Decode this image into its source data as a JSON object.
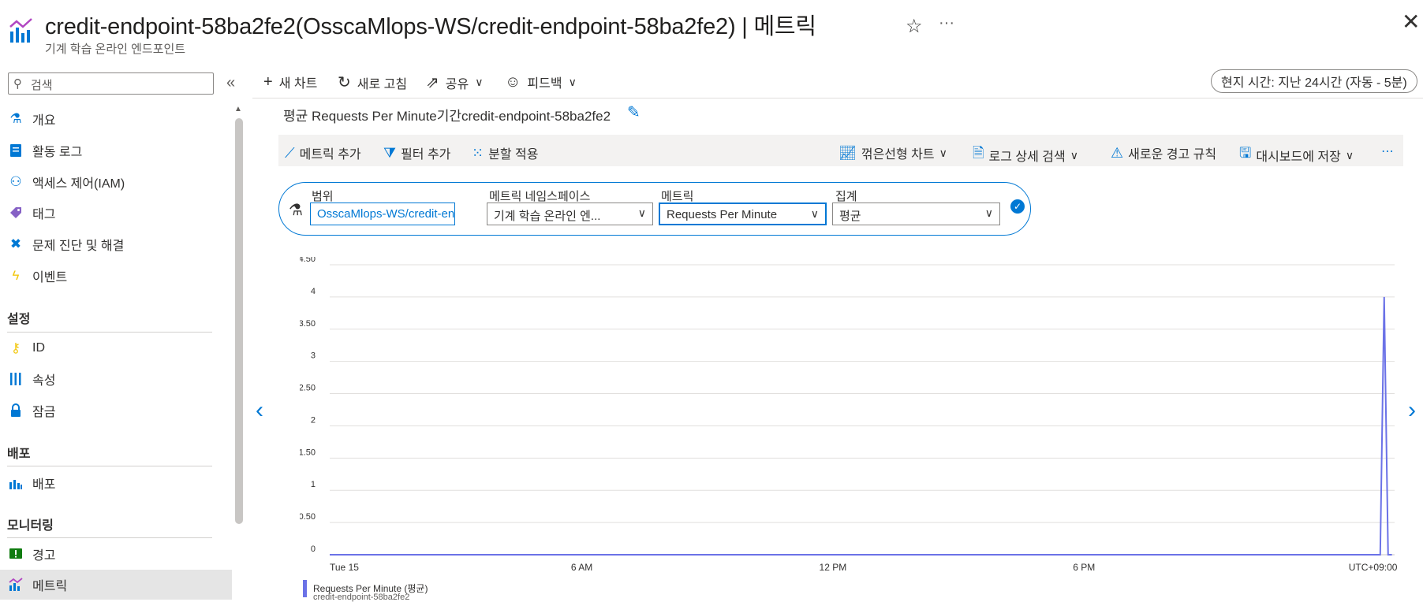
{
  "header": {
    "title": "credit-endpoint-58ba2fe2(OsscaMlops-WS/credit-endpoint-58ba2fe2) | 메트릭",
    "subtitle": "기계 학습 온라인 엔드포인트",
    "star_icon": "star-icon",
    "more_icon": "ellipsis-icon",
    "close_icon": "close-icon"
  },
  "sidebar": {
    "search_placeholder": "검색",
    "items": [
      {
        "label": "개요",
        "icon": "flask-icon",
        "color": "#0078d4"
      },
      {
        "label": "활동 로그",
        "icon": "log-icon",
        "color": "#0078d4"
      },
      {
        "label": "액세스 제어(IAM)",
        "icon": "people-icon",
        "color": "#0078d4"
      },
      {
        "label": "태그",
        "icon": "tag-icon",
        "color": "#8661c5"
      },
      {
        "label": "문제 진단 및 해결",
        "icon": "wrench-icon",
        "color": "#0078d4"
      },
      {
        "label": "이벤트",
        "icon": "bolt-icon",
        "color": "#f2c811"
      }
    ],
    "sections": [
      {
        "title": "설정",
        "items": [
          {
            "label": "ID",
            "icon": "key-icon",
            "color": "#f2c811"
          },
          {
            "label": "속성",
            "icon": "properties-icon",
            "color": "#0078d4"
          },
          {
            "label": "잠금",
            "icon": "lock-icon",
            "color": "#0078d4"
          }
        ]
      },
      {
        "title": "배포",
        "items": [
          {
            "label": "배포",
            "icon": "deploy-icon",
            "color": "#0078d4"
          }
        ]
      },
      {
        "title": "모니터링",
        "items": [
          {
            "label": "경고",
            "icon": "alert-icon",
            "color": "#107c10"
          },
          {
            "label": "메트릭",
            "icon": "metrics-icon",
            "color": "#0078d4",
            "selected": true
          }
        ]
      }
    ]
  },
  "commandbar": {
    "new_chart": "새 차트",
    "refresh": "새로 고침",
    "share": "공유",
    "feedback": "피드백",
    "time_range": "현지 시간: 지난 24시간 (자동 - 5분)"
  },
  "chart_header": {
    "title": "평균 Requests Per Minute기간credit-endpoint-58ba2fe2"
  },
  "toolbar": {
    "add_metric": "메트릭 추가",
    "add_filter": "필터 추가",
    "apply_split": "분할 적용",
    "chart_type": "꺾은선형 차트",
    "log_search": "로그 상세 검색",
    "new_alert": "새로운 경고 규칙",
    "save_dashboard": "대시보드에 저장",
    "more": "⋯"
  },
  "selector": {
    "scope_label": "범위",
    "scope_value": "OsscaMlops-WS/credit-en...",
    "namespace_label": "메트릭 네임스페이스",
    "namespace_value": "기계 학습 온라인 엔...",
    "metric_label": "메트릭",
    "metric_value": "Requests Per Minute",
    "aggregation_label": "집계",
    "aggregation_value": "평균"
  },
  "chart_data": {
    "type": "line",
    "series": [
      {
        "name": "Requests Per Minute (평균)",
        "color": "#6b72e7"
      }
    ],
    "ylim": [
      0,
      4.5
    ],
    "y_ticks": [
      "0",
      "0.50",
      "1",
      "1.50",
      "2",
      "2.50",
      "3",
      "3.50",
      "4",
      "4.50"
    ],
    "x_ticks": [
      "Tue 15",
      "6 AM",
      "12 PM",
      "6 PM",
      "UTC+09:00"
    ],
    "points": [
      {
        "t": 0.0,
        "v": 0
      },
      {
        "t": 0.9865,
        "v": 0
      },
      {
        "t": 0.9902,
        "v": 4
      },
      {
        "t": 0.9939,
        "v": 0
      },
      {
        "t": 0.9975,
        "v": 0
      }
    ],
    "grid": true,
    "legend": {
      "label": "Requests Per Minute (평균)",
      "sub": "credit-endpoint-58ba2fe2",
      "position": "bottom-left"
    }
  }
}
